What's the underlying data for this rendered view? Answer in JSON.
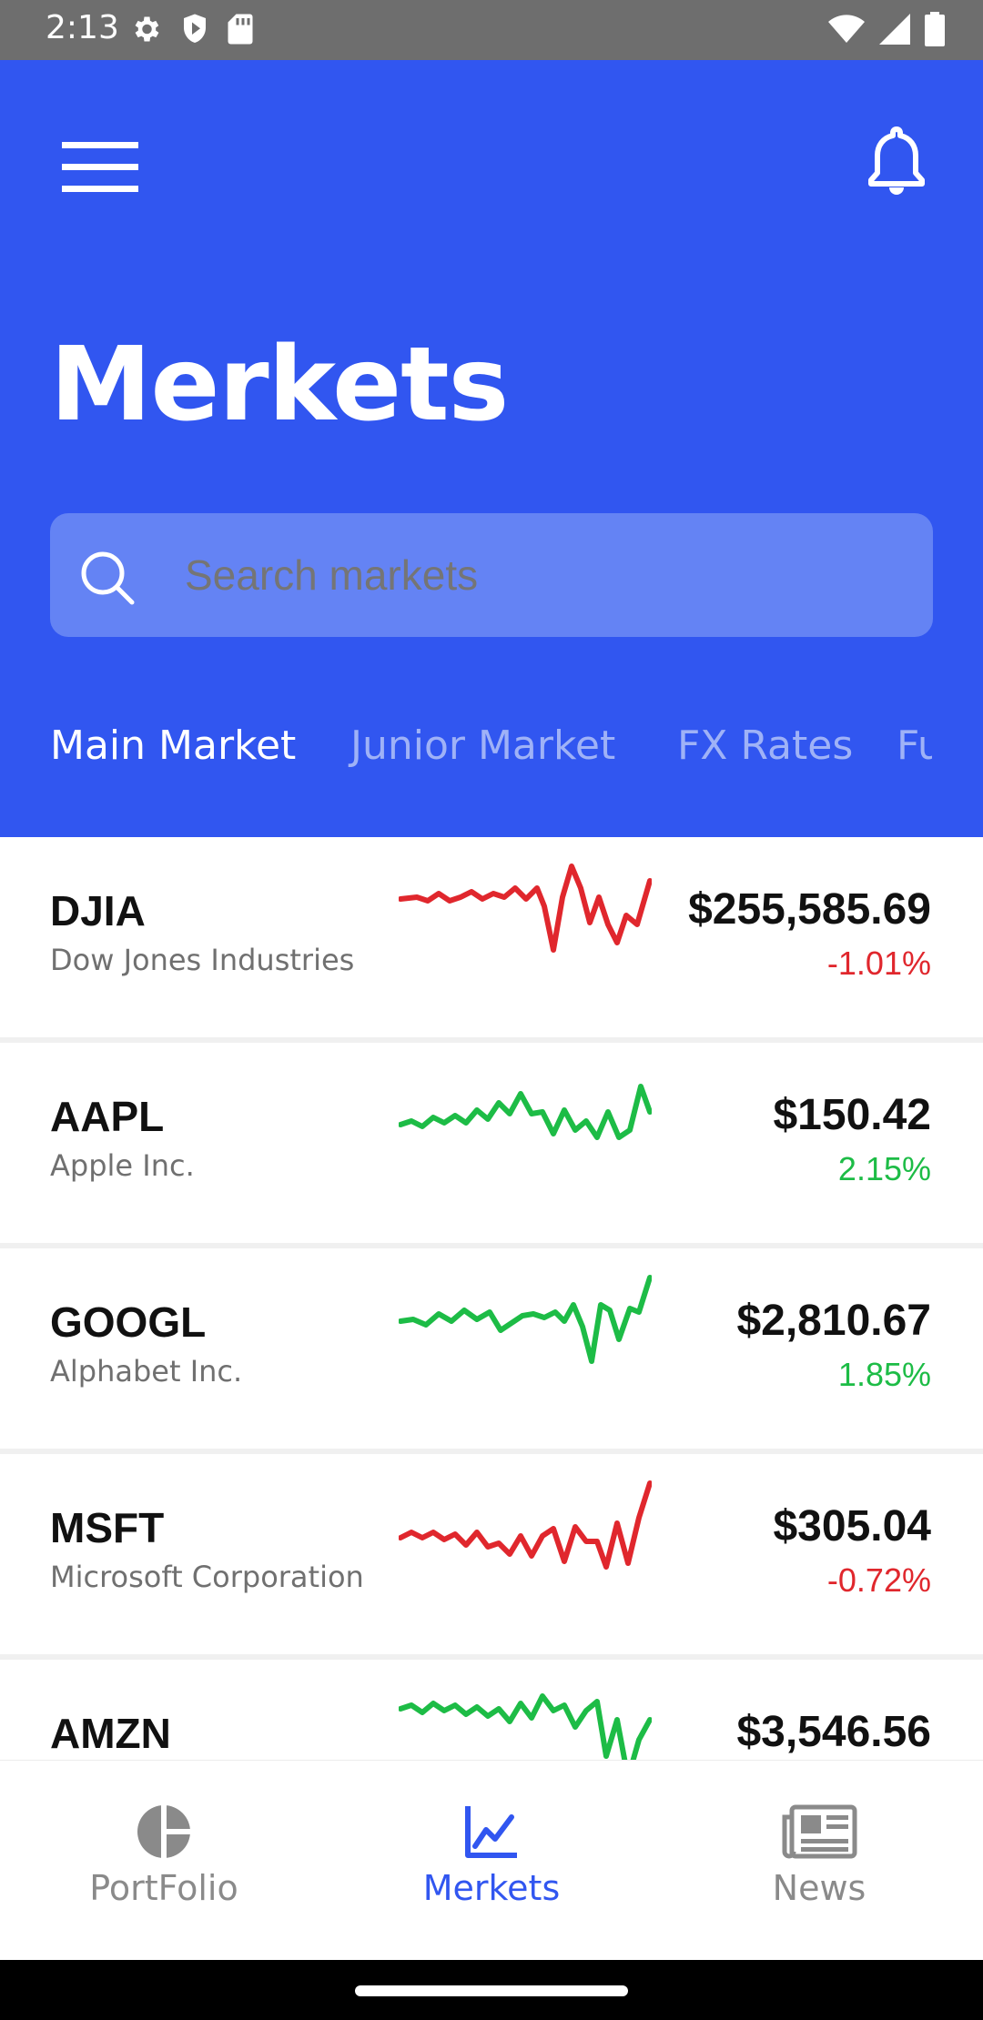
{
  "status_bar": {
    "time": "2:13",
    "left_icons": [
      "settings-gear-icon",
      "shield-play-icon",
      "sd-card-icon"
    ],
    "right_icons": [
      "wifi-icon",
      "cell-signal-icon",
      "battery-icon"
    ]
  },
  "header": {
    "title": "Merkets",
    "menu_icon": "hamburger-menu-icon",
    "notification_icon": "bell-icon",
    "background_color": "#3156f0"
  },
  "search": {
    "placeholder": "Search markets",
    "icon": "search-icon"
  },
  "tabs": [
    {
      "label": "Main Market",
      "active": true
    },
    {
      "label": "Junior Market",
      "active": false
    },
    {
      "label": "FX Rates",
      "active": false
    },
    {
      "label": "Fu",
      "active": false
    }
  ],
  "markets": [
    {
      "symbol": "DJIA",
      "name": "Dow Jones Industries",
      "price": "$255,585.69",
      "change": "-1.01%",
      "trend": "negative"
    },
    {
      "symbol": "AAPL",
      "name": "Apple Inc.",
      "price": "$150.42",
      "change": "2.15%",
      "trend": "positive"
    },
    {
      "symbol": "GOOGL",
      "name": "Alphabet Inc.",
      "price": "$2,810.67",
      "change": "1.85%",
      "trend": "positive"
    },
    {
      "symbol": "MSFT",
      "name": "Microsoft Corporation",
      "price": "$305.04",
      "change": "-0.72%",
      "trend": "negative"
    },
    {
      "symbol": "AMZN",
      "name": "",
      "price": "$3,546.56",
      "change": "",
      "trend": "positive"
    }
  ],
  "colors": {
    "positive": "#1dbc46",
    "negative": "#e0272d",
    "accent": "#3156f0"
  },
  "bottom_nav": [
    {
      "label": "PortFolio",
      "icon": "pie-chart-icon",
      "active": false
    },
    {
      "label": "Merkets",
      "icon": "line-chart-icon",
      "active": true
    },
    {
      "label": "News",
      "icon": "newspaper-icon",
      "active": false
    }
  ]
}
